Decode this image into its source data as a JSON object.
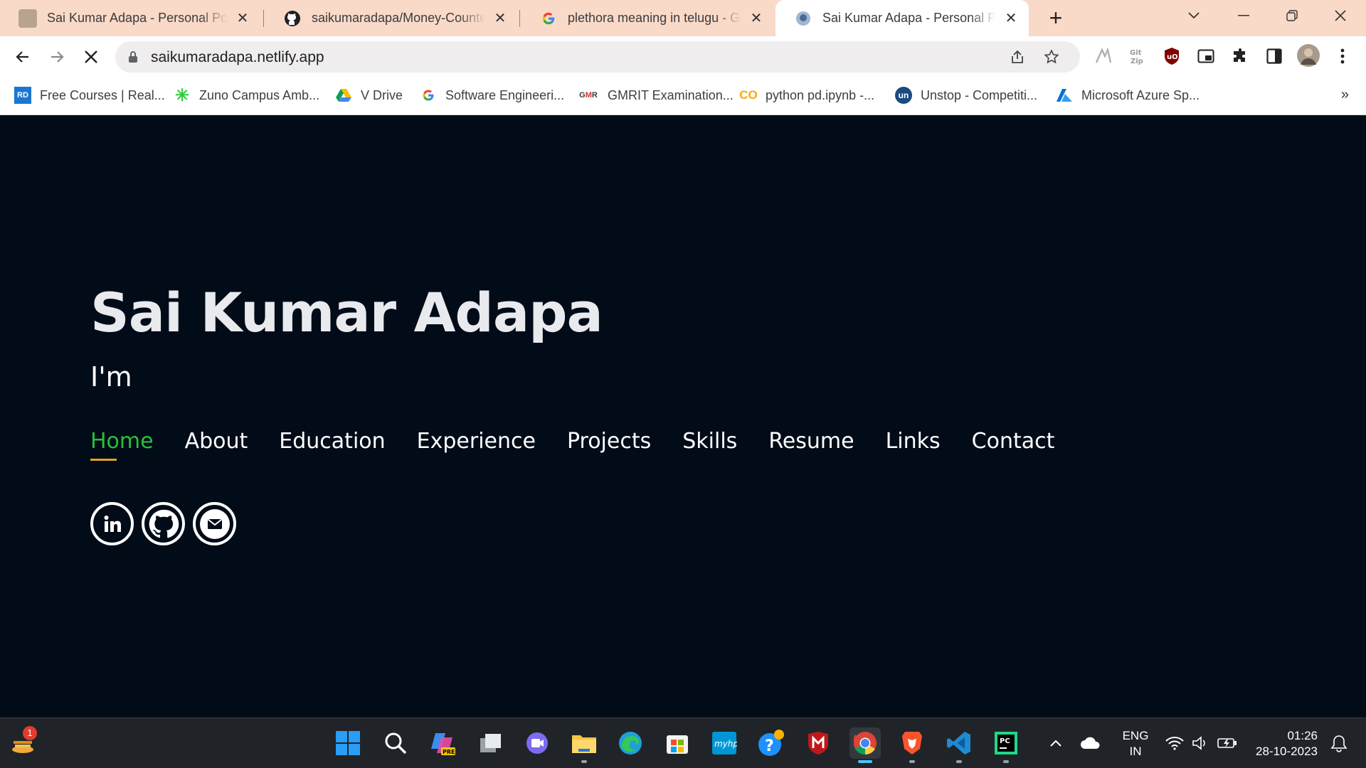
{
  "browser": {
    "tabs": [
      {
        "title": "Sai Kumar Adapa - Personal Port",
        "active": false
      },
      {
        "title": "saikumaradapa/Money-Counter",
        "active": false
      },
      {
        "title": "plethora meaning in telugu - Go",
        "active": false
      },
      {
        "title": "Sai Kumar Adapa - Personal Port",
        "active": true
      }
    ],
    "tab_close_glyph": "✕",
    "new_tab_glyph": "+",
    "url": "saikumaradapa.netlify.app",
    "bookmarks": [
      {
        "label": "Free Courses | Real...",
        "icon": "rd-icon"
      },
      {
        "label": "Zuno Campus Amb...",
        "icon": "zuno-icon"
      },
      {
        "label": "V Drive",
        "icon": "google-drive-icon"
      },
      {
        "label": "Software Engineeri...",
        "icon": "google-icon"
      },
      {
        "label": "GMRIT Examination...",
        "icon": "gmr-icon"
      },
      {
        "label": "python pd.ipynb -...",
        "icon": "colab-icon"
      },
      {
        "label": "Unstop - Competiti...",
        "icon": "unstop-icon"
      },
      {
        "label": "Microsoft Azure Sp...",
        "icon": "azure-icon"
      }
    ],
    "bookmarks_more": "»",
    "colors": {
      "tabstrip": "#f9d9c8",
      "accent": "#26c13a",
      "underline": "#e0a420"
    }
  },
  "page": {
    "name": "Sai Kumar Adapa",
    "intro": "I'm",
    "nav": [
      {
        "label": "Home",
        "active": true
      },
      {
        "label": "About"
      },
      {
        "label": "Education"
      },
      {
        "label": "Experience"
      },
      {
        "label": "Projects"
      },
      {
        "label": "Skills"
      },
      {
        "label": "Resume"
      },
      {
        "label": "Links"
      },
      {
        "label": "Contact"
      }
    ],
    "social": [
      "linkedin-icon",
      "github-icon",
      "mail-icon"
    ]
  },
  "taskbar": {
    "notification_count": "1",
    "language": "ENG",
    "region": "IN",
    "time": "01:26",
    "date": "28-10-2023"
  }
}
